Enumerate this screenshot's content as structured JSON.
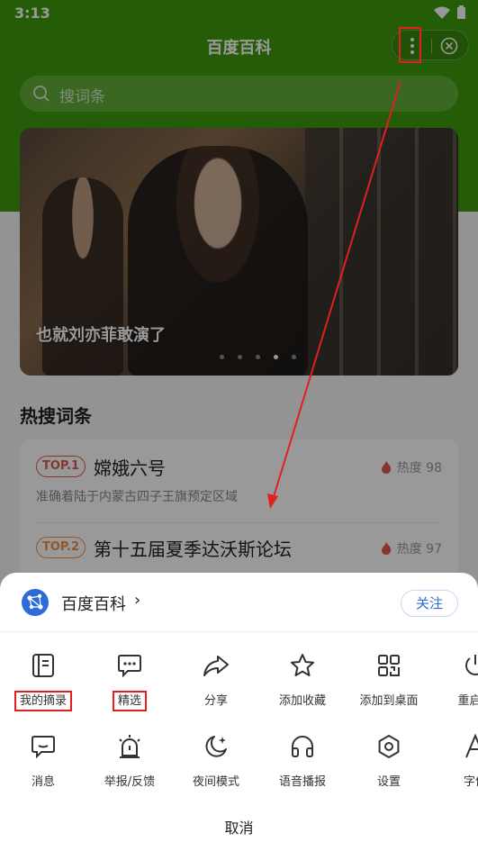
{
  "status": {
    "time": "3:13"
  },
  "titlebar": {
    "title": "百度百科"
  },
  "search": {
    "placeholder": "搜词条"
  },
  "banner": {
    "caption": "也就刘亦菲敢演了",
    "active_dot": 3,
    "dot_count": 5
  },
  "hot": {
    "section_title": "热搜词条",
    "items": [
      {
        "badge": "TOP.1",
        "name": "嫦娥六号",
        "heat_label": "热度 98",
        "desc": "准确着陆于内蒙古四子王旗预定区域",
        "badge_color": "#e05a4f"
      },
      {
        "badge": "TOP.2",
        "name": "第十五届夏季达沃斯论坛",
        "heat_label": "热度 97",
        "desc": "",
        "badge_color": "#f0904a"
      }
    ]
  },
  "sheet": {
    "app_name": "百度百科",
    "chevron": "›",
    "follow_label": "关注",
    "row1": [
      {
        "label": "我的摘录",
        "icon": "notebook-icon"
      },
      {
        "label": "精选",
        "icon": "chat-bubble-icon"
      },
      {
        "label": "分享",
        "icon": "share-arrow-icon"
      },
      {
        "label": "添加收藏",
        "icon": "star-icon"
      },
      {
        "label": "添加到桌面",
        "icon": "qr-grid-icon"
      },
      {
        "label": "重启小",
        "icon": "power-icon"
      }
    ],
    "row2": [
      {
        "label": "消息",
        "icon": "message-icon"
      },
      {
        "label": "举报/反馈",
        "icon": "alarm-icon"
      },
      {
        "label": "夜间模式",
        "icon": "moon-icon"
      },
      {
        "label": "语音播报",
        "icon": "headphones-icon"
      },
      {
        "label": "设置",
        "icon": "settings-icon"
      },
      {
        "label": "字体",
        "icon": "font-icon"
      }
    ],
    "cancel_label": "取消"
  },
  "colors": {
    "brand_green": "#3f9a0c",
    "accent_blue": "#2f6ad9",
    "annotation_red": "#e02020"
  }
}
